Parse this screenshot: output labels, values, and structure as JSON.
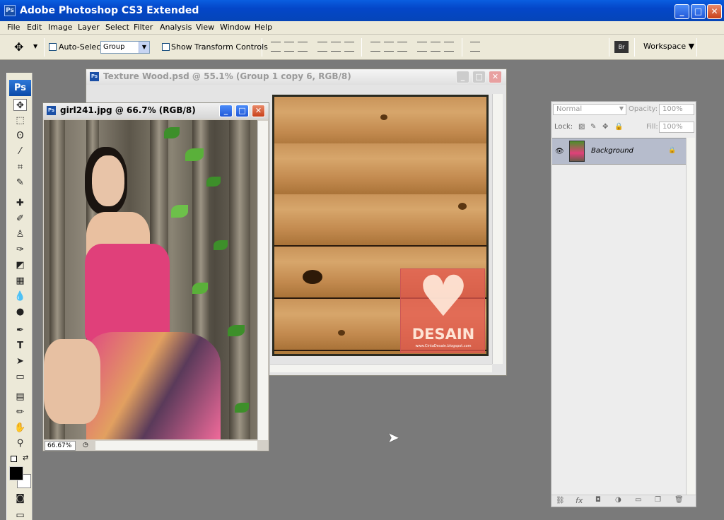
{
  "window": {
    "title": "Adobe Photoshop CS3 Extended",
    "app_icon": "Ps"
  },
  "menu": [
    "File",
    "Edit",
    "Image",
    "Layer",
    "Select",
    "Filter",
    "Analysis",
    "View",
    "Window",
    "Help"
  ],
  "options": {
    "auto_select_label": "Auto-Select:",
    "auto_select_value": "Group",
    "show_transform_label": "Show Transform Controls",
    "workspace_label": "Workspace",
    "bridge_icon_label": "Br"
  },
  "toolbox": {
    "logo": "Ps"
  },
  "doc_wood": {
    "title": "Texture Wood.psd @ 55.1% (Group 1 copy 6, RGB/8)",
    "watermark": "DESAIN",
    "watermark_url": "www.CintaDesain.blogspot.com"
  },
  "doc_girl": {
    "title": "girl241.jpg @ 66.7% (RGB/8)",
    "zoom": "66.67%"
  },
  "layers": {
    "blend_mode": "Normal",
    "opacity_label": "Opacity:",
    "opacity_value": "100%",
    "lock_label": "Lock:",
    "fill_label": "Fill:",
    "fill_value": "100%",
    "layer_name": "Background"
  },
  "colors": {
    "titlebar": "#0a5ee0",
    "workspace_bg": "#7a7a7a",
    "chrome": "#ece9d8",
    "accent_pink": "#e0407a"
  }
}
